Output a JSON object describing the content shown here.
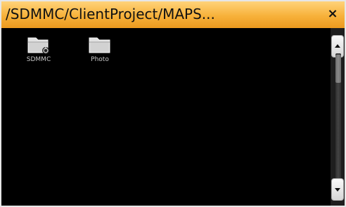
{
  "window": {
    "title": "/SDMMC/ClientProject/MAPS...",
    "close_label": "×"
  },
  "items": [
    {
      "label": "SDMMC",
      "icon": "sd-card-folder-icon"
    },
    {
      "label": "Photo",
      "icon": "folder-icon"
    }
  ],
  "scrollbar": {
    "up_icon": "arrow-up-icon",
    "down_icon": "arrow-down-icon"
  },
  "colors": {
    "title_bar": "#f7b13a",
    "background": "#000000"
  }
}
